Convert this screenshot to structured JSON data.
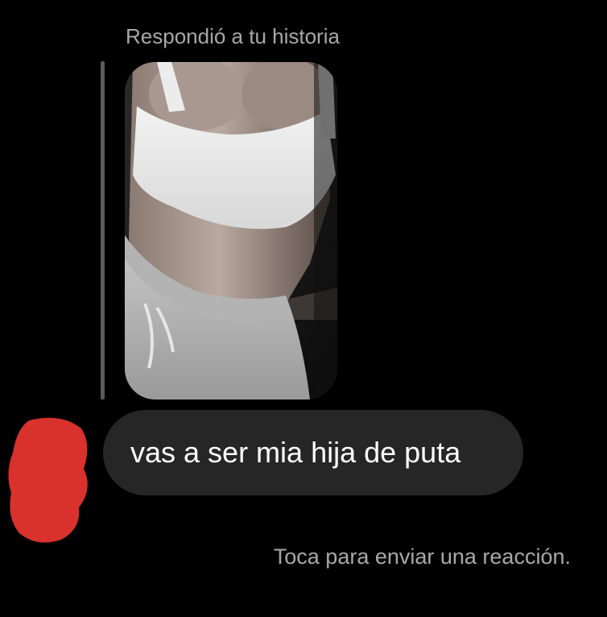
{
  "reply_header": "Respondió a tu historia",
  "story_thumbnail": {
    "icon": "story-photo"
  },
  "avatar": {
    "redaction_color": "#d9312b"
  },
  "message": {
    "text": "vas a ser mia hija de puta"
  },
  "reaction_hint": "Toca para enviar una reacción."
}
